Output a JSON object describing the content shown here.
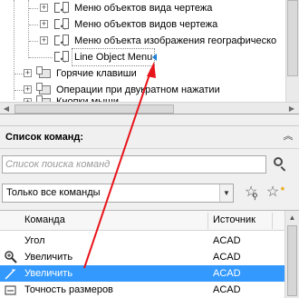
{
  "tree": {
    "items": [
      {
        "label": "Меню объектов вида чертежа"
      },
      {
        "label": "Меню объектов видов чертежа"
      },
      {
        "label": "Меню объекта изображения географическо"
      },
      {
        "label": "Line Object Menu"
      },
      {
        "label": "Горячие клавиши"
      },
      {
        "label": "Операции при двукратном нажатии"
      },
      {
        "label": "Кнопки мыши"
      }
    ]
  },
  "command_panel": {
    "title": "Список команд:",
    "collapse_icon": "double-chevron-up-icon",
    "search_placeholder": "Список поиска команд",
    "filter_selected": "Только все команды",
    "table": {
      "columns": [
        "Команда",
        "Источник"
      ],
      "rows": [
        {
          "name": "Угол",
          "source": "ACAD",
          "selected": false
        },
        {
          "name": "Увеличить",
          "source": "ACAD",
          "selected": false
        },
        {
          "name": "Увеличить",
          "source": "ACAD",
          "selected": true
        },
        {
          "name": "Точность размеров",
          "source": "ACAD",
          "selected": false
        }
      ]
    }
  },
  "colors": {
    "selection": "#3399ff",
    "annotation_arrow": "#e8141b",
    "marker": "#1e7fd6"
  }
}
